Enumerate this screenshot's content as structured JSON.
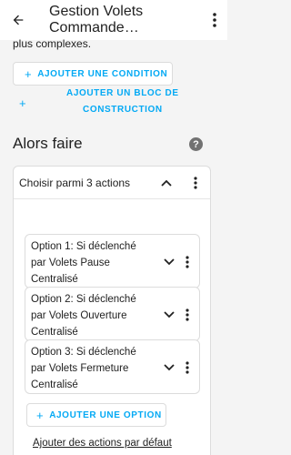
{
  "appbar": {
    "title": "Gestion Volets Commande…"
  },
  "intro_text": "plus complexes.",
  "add_condition_label": "AJOUTER UNE CONDITION",
  "add_block_label_line1": "AJOUTER UN BLOC DE",
  "add_block_label_line2": "CONSTRUCTION",
  "section_title": "Alors faire",
  "help_symbol": "?",
  "choose_block": {
    "label": "Choisir parmi 3 actions",
    "options": [
      {
        "line1": "Option 1: Si déclenché",
        "line2": "par Volets Pause",
        "line3": "Centralisé"
      },
      {
        "line1": "Option 2: Si déclenché",
        "line2": "par Volets Ouverture",
        "line3": "Centralisé"
      },
      {
        "line1": "Option 3: Si déclenché",
        "line2": "par Volets Fermeture",
        "line3": "Centralisé"
      }
    ],
    "add_option_label": "AJOUTER UNE OPTION",
    "default_actions_label": "Ajouter des actions par défaut"
  },
  "colors": {
    "accent": "#03a9f4",
    "background": "#f4f4f4",
    "text": "#212121"
  },
  "icons": {
    "back": "arrow-left-icon",
    "more": "more-vertical-icon",
    "help": "help-circle-icon",
    "chevron_up": "chevron-up-icon",
    "chevron_down": "chevron-down-icon",
    "plus": "plus-icon"
  }
}
